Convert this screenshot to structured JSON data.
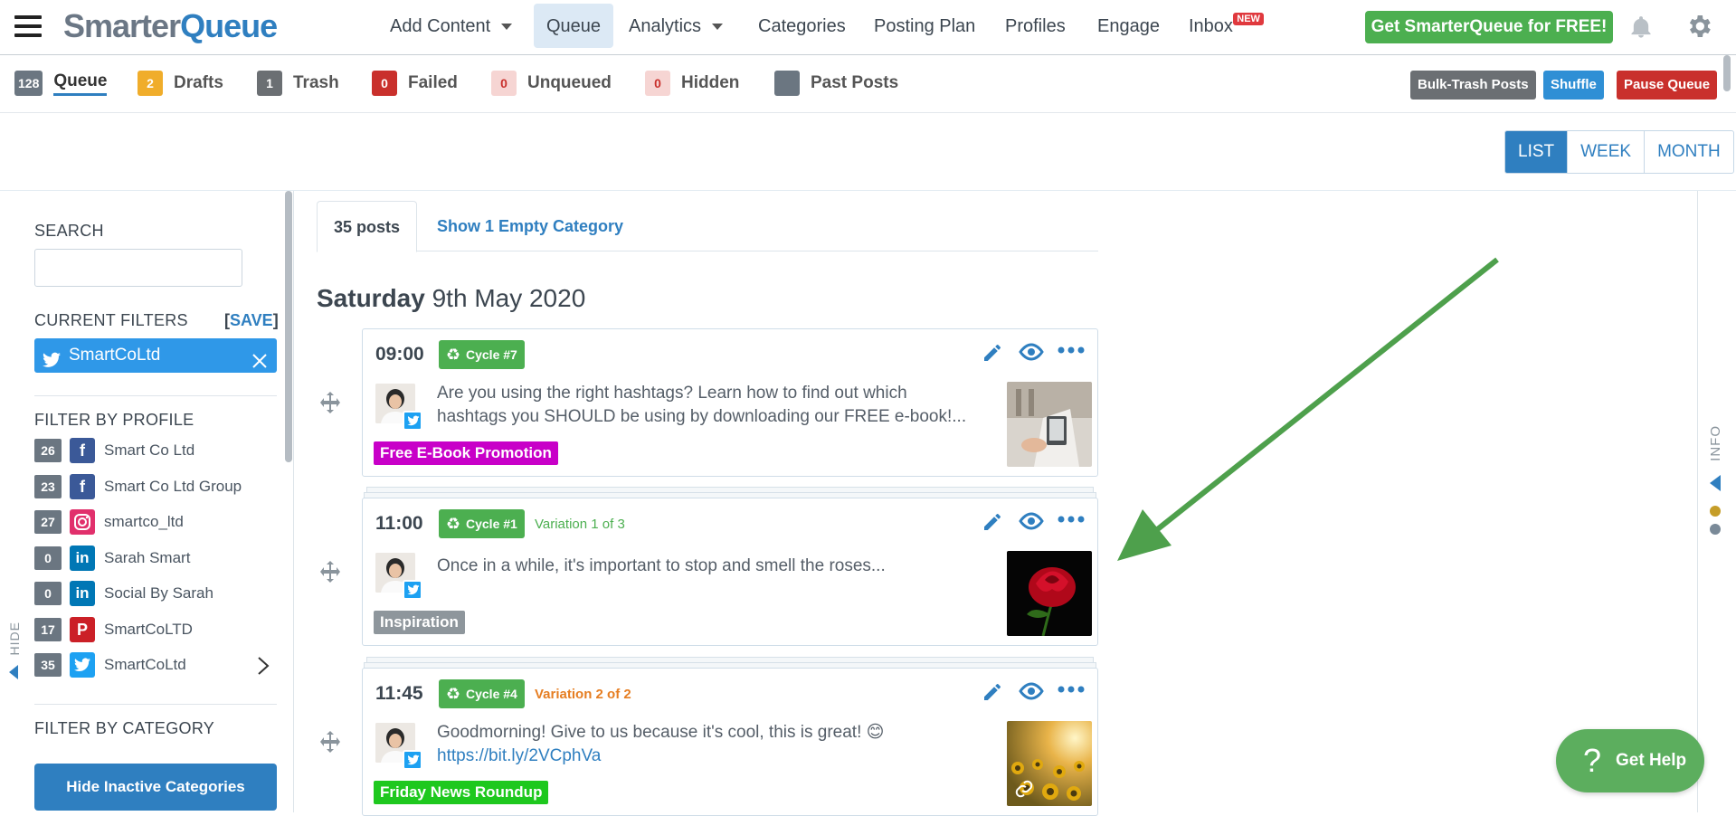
{
  "brand": {
    "part1": "Smarter",
    "part2": "Queue"
  },
  "nav": {
    "items": [
      "Add Content",
      "Queue",
      "Analytics",
      "Categories",
      "Posting Plan",
      "Profiles",
      "Engage",
      "Inbox"
    ],
    "inbox_badge": "NEW",
    "cta": "Get SmarterQueue for FREE!"
  },
  "queue_tabs": [
    {
      "count": "128",
      "label": "Queue",
      "color": "#6b7681"
    },
    {
      "count": "2",
      "label": "Drafts",
      "color": "#f0ad2b"
    },
    {
      "count": "1",
      "label": "Trash",
      "color": "#6b6f73"
    },
    {
      "count": "0",
      "label": "Failed",
      "color": "#c9302c"
    },
    {
      "count": "0",
      "label": "Unqueued",
      "color": "#f6d5d3"
    },
    {
      "count": "0",
      "label": "Hidden",
      "color": "#f6d5d3"
    },
    {
      "count": "",
      "label": "Past Posts",
      "color": "#6b7681"
    }
  ],
  "actions": {
    "bulk_trash": "Bulk-Trash Posts",
    "shuffle": "Shuffle",
    "pause": "Pause Queue"
  },
  "view_toggle": [
    "LIST",
    "WEEK",
    "MONTH"
  ],
  "sidebar": {
    "search_title": "SEARCH",
    "search_placeholder": "",
    "filters_title": "CURRENT FILTERS",
    "save_label": "SAVE",
    "active_filter": "SmartCoLtd",
    "by_profile_title": "FILTER BY PROFILE",
    "profiles": [
      {
        "count": "26",
        "name": "Smart Co Ltd",
        "network": "facebook"
      },
      {
        "count": "23",
        "name": "Smart Co Ltd Group",
        "network": "facebook-group"
      },
      {
        "count": "27",
        "name": "smartco_ltd",
        "network": "instagram"
      },
      {
        "count": "0",
        "name": "Sarah Smart",
        "network": "linkedin"
      },
      {
        "count": "0",
        "name": "Social By Sarah",
        "network": "linkedin"
      },
      {
        "count": "17",
        "name": "SmartCoLTD",
        "network": "pinterest"
      },
      {
        "count": "35",
        "name": "SmartCoLtd",
        "network": "twitter"
      }
    ],
    "by_category_title": "FILTER BY CATEGORY",
    "hide_inactive": "Hide Inactive Categories",
    "hide_tab": "HIDE"
  },
  "feed": {
    "posts_tab": "35 posts",
    "empty_tab": "Show 1 Empty Category",
    "date_day": "Saturday",
    "date_rest": "9th May 2020",
    "posts": [
      {
        "time": "09:00",
        "cycle": "Cycle #7",
        "variation": "",
        "text1": "Are you using the right hashtags? Learn how to find out which",
        "text2": "hashtags you SHOULD be using by downloading our FREE e-book!...",
        "link": "",
        "tag": "Free E-Book Promotion",
        "tag_color": "#c800c8"
      },
      {
        "time": "11:00",
        "cycle": "Cycle #1",
        "variation": "Variation 1 of 3",
        "variation_color": "#4caf50",
        "text1": "Once in a while, it's important to stop and smell the roses...",
        "text2": "",
        "link": "",
        "tag": "Inspiration",
        "tag_color": "#8e969c"
      },
      {
        "time": "11:45",
        "cycle": "Cycle #4",
        "variation": "Variation 2 of 2",
        "variation_color": "#e67e22",
        "text1": "Goodmorning! Give to us because it's cool, this is great! 😊",
        "text2": "",
        "link": "https://bit.ly/2VCphVa",
        "tag": "Friday News Roundup",
        "tag_color": "#1ec81e"
      }
    ]
  },
  "info_tab": "INFO",
  "help": "Get Help"
}
